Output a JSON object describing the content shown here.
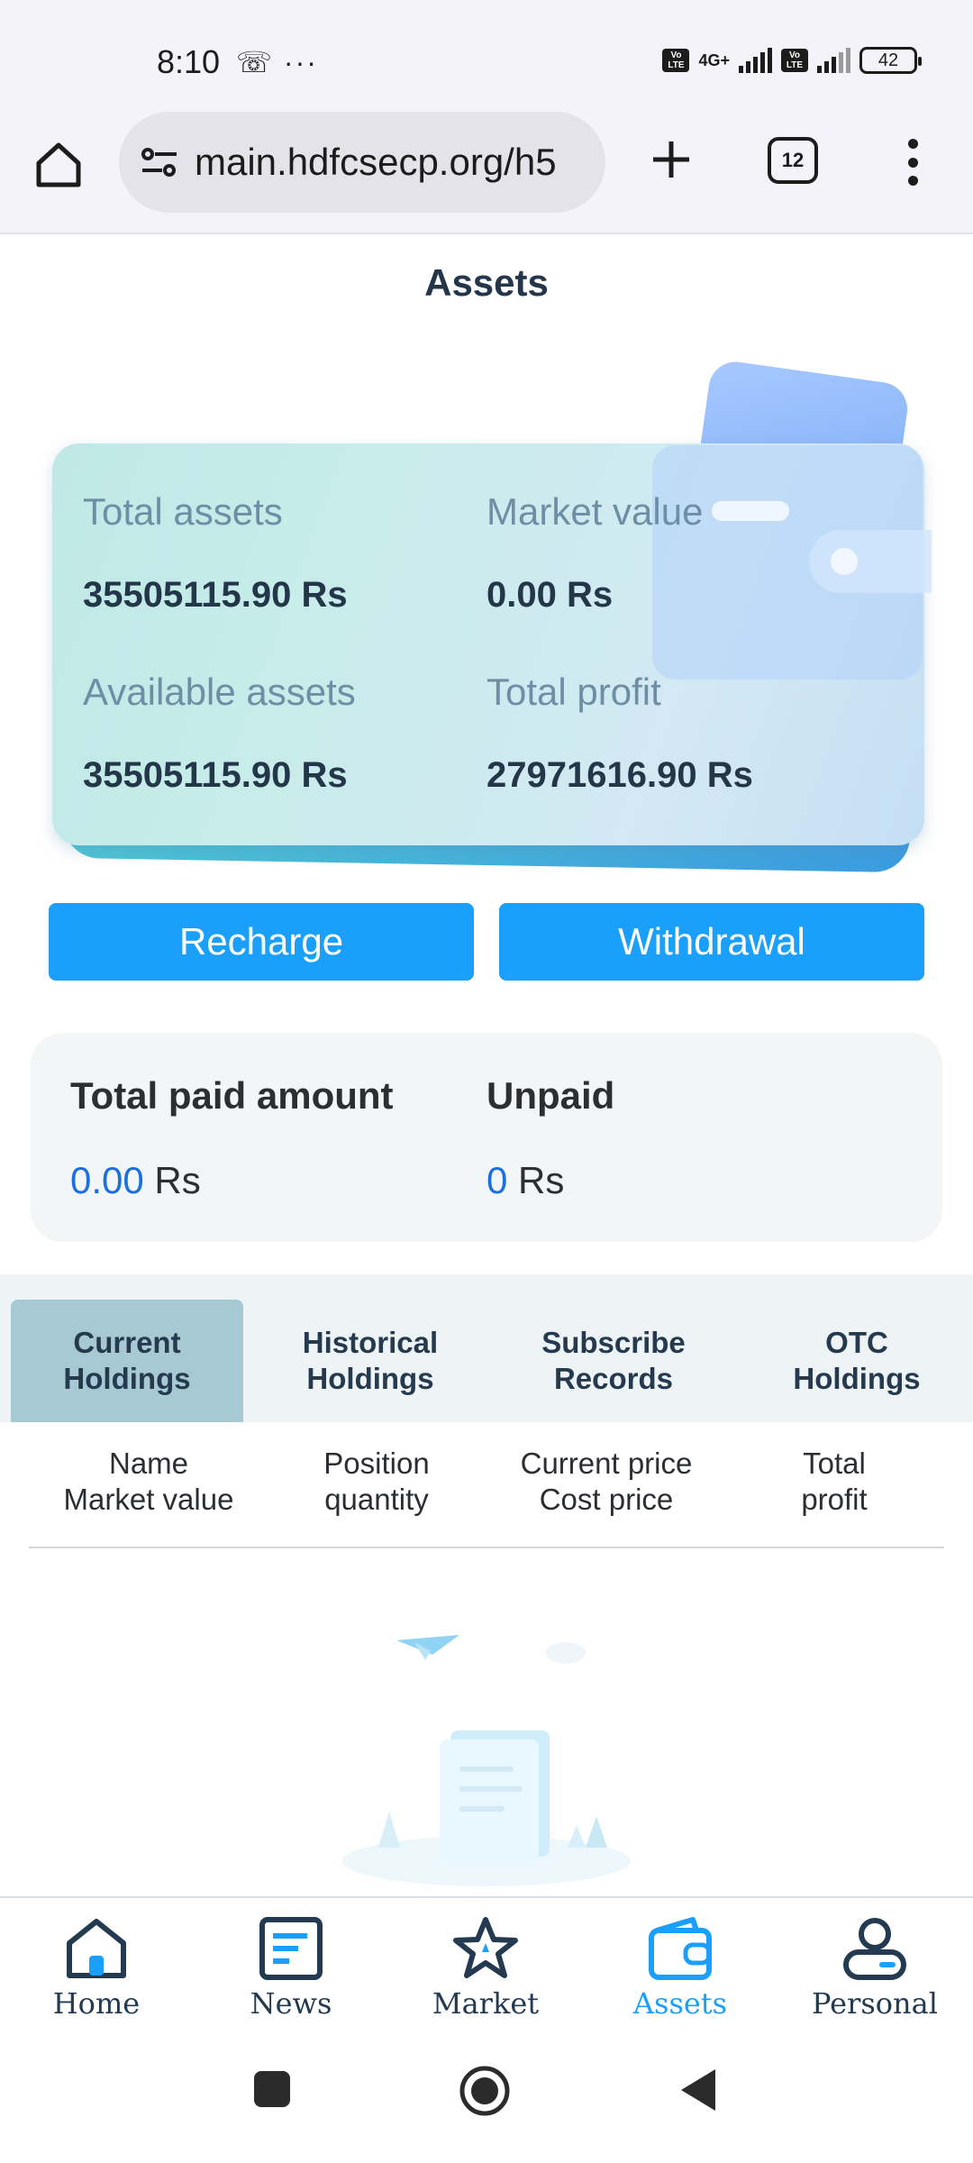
{
  "status_bar": {
    "time": "8:10",
    "left_icons": "☏ ···",
    "network_type": "4G+",
    "battery": "42"
  },
  "browser": {
    "url": "main.hdfcsecp.org/h5",
    "tab_count": "12"
  },
  "page": {
    "title": "Assets"
  },
  "assets_card": {
    "total_assets_label": "Total assets",
    "total_assets_value": "35505115.90 Rs",
    "market_value_label": "Market value",
    "market_value_value": "0.00 Rs",
    "available_assets_label": "Available assets",
    "available_assets_value": "35505115.90 Rs",
    "total_profit_label": "Total profit",
    "total_profit_value": "27971616.90 Rs"
  },
  "actions": {
    "recharge_label": "Recharge",
    "withdrawal_label": "Withdrawal"
  },
  "payment": {
    "paid_label": "Total paid amount",
    "paid_number": "0.00",
    "paid_unit": " Rs",
    "unpaid_label": "Unpaid",
    "unpaid_number": "0",
    "unpaid_unit": " Rs"
  },
  "holdings_tabs": [
    {
      "line1": "Current",
      "line2": "Holdings",
      "active": true
    },
    {
      "line1": "Historical",
      "line2": "Holdings",
      "active": false
    },
    {
      "line1": "Subscribe",
      "line2": "Records",
      "active": false
    },
    {
      "line1": "OTC",
      "line2": "Holdings",
      "active": false
    }
  ],
  "table_headers": [
    {
      "line1": "Name",
      "line2": "Market value"
    },
    {
      "line1": "Position",
      "line2": "quantity"
    },
    {
      "line1": "Current price",
      "line2": "Cost price"
    },
    {
      "line1": "Total",
      "line2": "profit"
    }
  ],
  "bottom_nav": [
    {
      "label": "Home",
      "icon": "home-icon",
      "active": false
    },
    {
      "label": "News",
      "icon": "news-icon",
      "active": false
    },
    {
      "label": "Market",
      "icon": "star-icon",
      "active": false
    },
    {
      "label": "Assets",
      "icon": "wallet-icon",
      "active": true
    },
    {
      "label": "Personal",
      "icon": "person-icon",
      "active": false
    }
  ],
  "colors": {
    "accent": "#1aa0fb",
    "paid_number": "#1c6fe0",
    "active_tab": "#a6c9d3"
  }
}
